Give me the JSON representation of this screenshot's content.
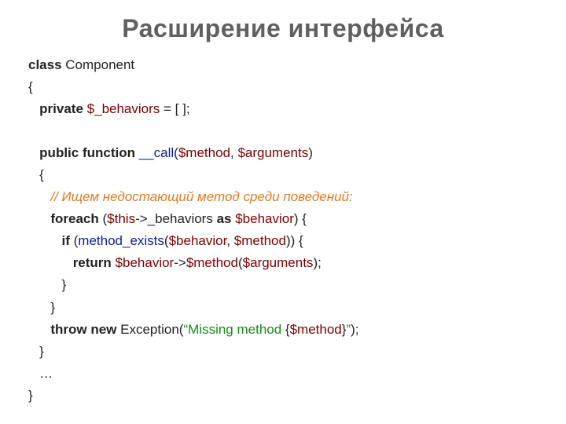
{
  "title": "Расширение интерфейса",
  "code": {
    "l1_kw": "class",
    "l1_txt": " Component",
    "l2": "{",
    "l3_kw": "private",
    "l3_sp": " ",
    "l3_var": "$_behaviors",
    "l3_rest": " = [ ];",
    "l5_kw": "public function",
    "l5_sp": " ",
    "l5_fn": "__call",
    "l5_p1": "(",
    "l5_a1": "$method",
    "l5_c1": ", ",
    "l5_a2": "$arguments",
    "l5_p2": ")",
    "l6": "{",
    "l7_cmt": "// Ищем недостающий метод среди поведений:",
    "l8_kw": "foreach",
    "l8_p1": " (",
    "l8_v1": "$this",
    "l8_arrow": "->",
    "l8_v2": "_behaviors",
    "l8_as": " as ",
    "l8_v3": "$behavior",
    "l8_p2": ") {",
    "l9_kw": "if",
    "l9_p1": " (",
    "l9_fn": "method_exists",
    "l9_p2": "(",
    "l9_a1": "$behavior",
    "l9_c1": ", ",
    "l9_a2": "$method",
    "l9_p3": ")) {",
    "l10_kw": "return",
    "l10_sp": " ",
    "l10_v1": "$behavior",
    "l10_arrow": "->",
    "l10_v2": "$method",
    "l10_p1": "(",
    "l10_a1": "$arguments",
    "l10_p2": ");",
    "l11": "}",
    "l12": "}",
    "l13_kw": "throw new",
    "l13_sp": " ",
    "l13_ex": "Exception(",
    "l13_s1": "“Missing method ",
    "l13_br1": "{",
    "l13_mv": "$method",
    "l13_br2": "}",
    "l13_s2": "”",
    "l13_end": ");",
    "l14": "}",
    "l15": "…",
    "l16": "}"
  }
}
